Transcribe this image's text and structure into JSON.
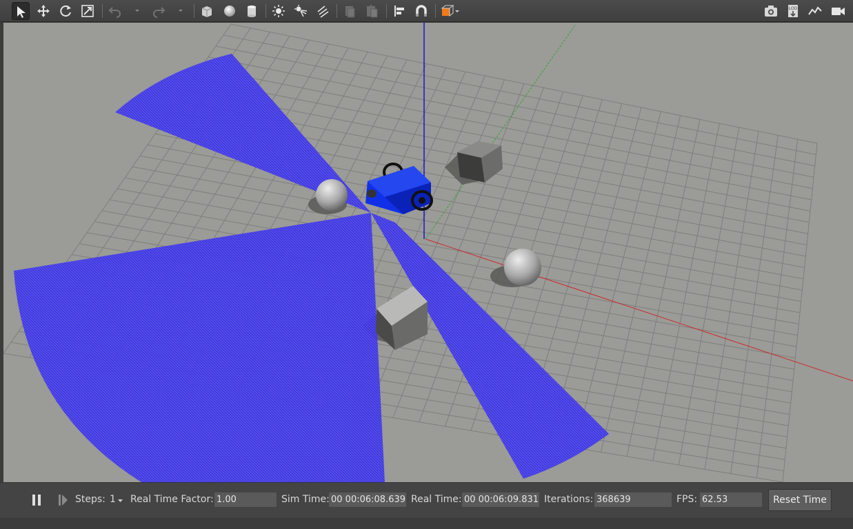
{
  "toolbar": {
    "tools": [
      {
        "icon": "select-arrow-icon",
        "tooltip": "",
        "active": true
      },
      {
        "icon": "translate-icon"
      },
      {
        "icon": "rotate-icon"
      },
      {
        "icon": "scale-icon"
      },
      {
        "icon": "undo-icon"
      },
      {
        "icon": "redo-icon"
      },
      {
        "icon": "box-shape-icon"
      },
      {
        "icon": "sphere-shape-icon"
      },
      {
        "icon": "cylinder-shape-icon"
      },
      {
        "icon": "point-light-icon"
      },
      {
        "icon": "spot-light-icon"
      },
      {
        "icon": "directional-light-icon"
      },
      {
        "icon": "copy-icon"
      },
      {
        "icon": "paste-icon"
      },
      {
        "icon": "align-icon"
      },
      {
        "icon": "snap-magnet-icon"
      },
      {
        "icon": "view-angle-icon"
      },
      {
        "icon": "screenshot-camera-icon"
      },
      {
        "icon": "log-icon",
        "text": "LOG"
      },
      {
        "icon": "plot-icon"
      },
      {
        "icon": "video-record-icon"
      }
    ],
    "accent_color": "#ee7a1b"
  },
  "scene": {
    "laser_color": "#2a1ff0",
    "robot_color": "#1030e8",
    "floor_color": "#9b9b98",
    "axis_colors": {
      "x": "#cc2a2a",
      "y": "#2ea82e",
      "z": "#1414cc"
    }
  },
  "bottom": {
    "steps_label": "Steps:",
    "steps_value": "1",
    "rtf_label": "Real Time Factor:",
    "rtf_value": "1.00",
    "sim_label": "Sim Time:",
    "sim_value": "00 00:06:08.639",
    "real_label": "Real Time:",
    "real_value": "00 00:06:09.831",
    "iter_label": "Iterations:",
    "iter_value": "368639",
    "fps_label": "FPS:",
    "fps_value": "62.53",
    "reset_label": "Reset Time"
  }
}
